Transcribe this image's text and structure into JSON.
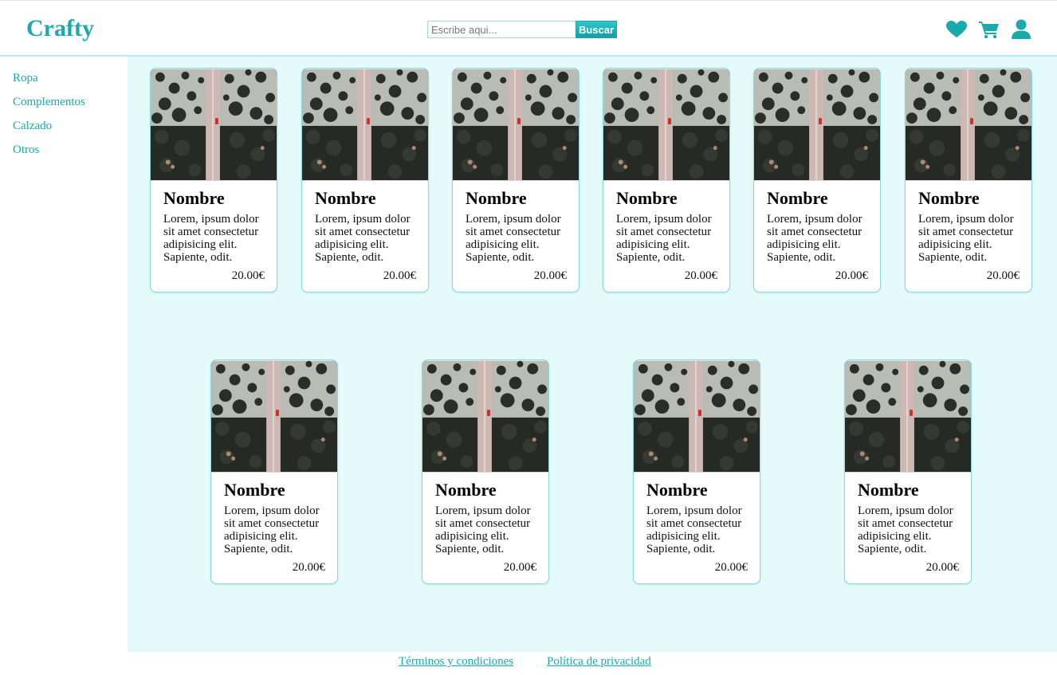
{
  "brand": {
    "name": "Crafty",
    "accent": "#1aa9ad",
    "background_main": "#e5fbfb"
  },
  "search": {
    "placeholder": "Escribe aqui...",
    "value": "",
    "button_label": "Buscar"
  },
  "header_icons": [
    "heart-icon",
    "cart-icon",
    "user-icon"
  ],
  "sidebar": {
    "items": [
      {
        "label": "Ropa"
      },
      {
        "label": "Complementos"
      },
      {
        "label": "Calzado"
      },
      {
        "label": "Otros"
      }
    ]
  },
  "products": [
    {
      "name": "Nombre",
      "description": "Lorem, ipsum dolor sit amet consectetur adipisicing elit. Sapiente, odit.",
      "price": "20.00€"
    },
    {
      "name": "Nombre",
      "description": "Lorem, ipsum dolor sit amet consectetur adipisicing elit. Sapiente, odit.",
      "price": "20.00€"
    },
    {
      "name": "Nombre",
      "description": "Lorem, ipsum dolor sit amet consectetur adipisicing elit. Sapiente, odit.",
      "price": "20.00€"
    },
    {
      "name": "Nombre",
      "description": "Lorem, ipsum dolor sit amet consectetur adipisicing elit. Sapiente, odit.",
      "price": "20.00€"
    },
    {
      "name": "Nombre",
      "description": "Lorem, ipsum dolor sit amet consectetur adipisicing elit. Sapiente, odit.",
      "price": "20.00€"
    },
    {
      "name": "Nombre",
      "description": "Lorem, ipsum dolor sit amet consectetur adipisicing elit. Sapiente, odit.",
      "price": "20.00€"
    },
    {
      "name": "Nombre",
      "description": "Lorem, ipsum dolor sit amet consectetur adipisicing elit. Sapiente, odit.",
      "price": "20.00€"
    },
    {
      "name": "Nombre",
      "description": "Lorem, ipsum dolor sit amet consectetur adipisicing elit. Sapiente, odit.",
      "price": "20.00€"
    },
    {
      "name": "Nombre",
      "description": "Lorem, ipsum dolor sit amet consectetur adipisicing elit. Sapiente, odit.",
      "price": "20.00€"
    },
    {
      "name": "Nombre",
      "description": "Lorem, ipsum dolor sit amet consectetur adipisicing elit. Sapiente, odit.",
      "price": "20.00€"
    }
  ],
  "footer": {
    "links": [
      {
        "label": "Términos y condiciones"
      },
      {
        "label": "Política de privacidad"
      }
    ]
  }
}
